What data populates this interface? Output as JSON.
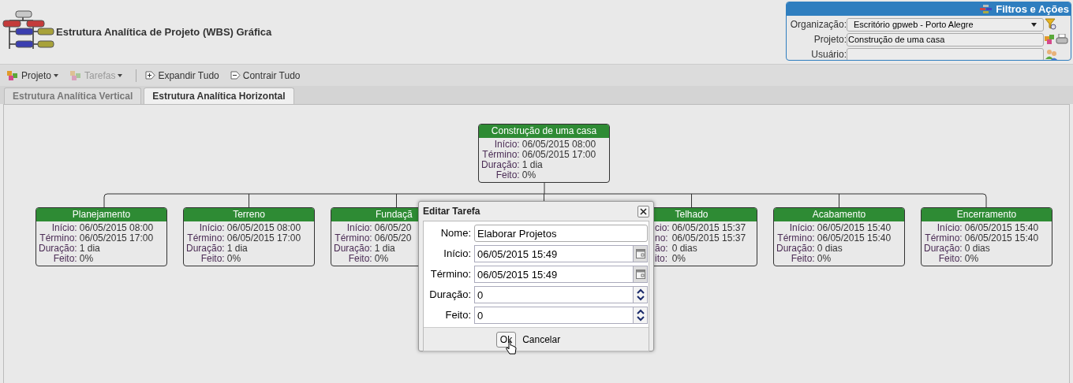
{
  "header": {
    "title": "Estrutura Analítica de Projeto (WBS) Gráfica"
  },
  "filters": {
    "title": "Filtros e Ações",
    "organization": {
      "label": "Organização:",
      "value": "Escritório gpweb - Porto Alegre"
    },
    "project": {
      "label": "Projeto:",
      "value": "Construção de uma casa"
    },
    "user": {
      "label": "Usuário:"
    }
  },
  "toolbar": [
    {
      "label": "Projeto",
      "kind": "menu",
      "disabled": false
    },
    {
      "label": "Tarefas",
      "kind": "menu",
      "disabled": true
    },
    {
      "label": "Expandir Tudo",
      "kind": "expand",
      "disabled": false
    },
    {
      "label": "Contrair Tudo",
      "kind": "collapse",
      "disabled": false
    }
  ],
  "tabs": [
    {
      "label": "Estrutura Analítica Vertical",
      "selected": false
    },
    {
      "label": "Estrutura Analítica Horizontal",
      "selected": true
    }
  ],
  "root": {
    "title": "Construção de uma casa",
    "rows": [
      {
        "label": "Início:",
        "value": "06/05/2015 08:00"
      },
      {
        "label": "Término:",
        "value": "06/05/2015 17:00"
      },
      {
        "label": "Duração:",
        "value": "1 dia"
      },
      {
        "label": "Feito:",
        "value": "0%"
      }
    ]
  },
  "nodes": [
    {
      "kind": "full",
      "title": "Planejamento",
      "rows": [
        {
          "label": "Início:",
          "value": "06/05/2015 08:00"
        },
        {
          "label": "Término:",
          "value": "06/05/2015 17:00"
        },
        {
          "label": "Duração:",
          "value": "1 dia"
        },
        {
          "label": "Feito:",
          "value": "0%"
        }
      ]
    },
    {
      "kind": "full",
      "title": "Terreno",
      "rows": [
        {
          "label": "Início:",
          "value": "06/05/2015 08:00"
        },
        {
          "label": "Término:",
          "value": "06/05/2015 17:00"
        },
        {
          "label": "Duração:",
          "value": "1 dia"
        },
        {
          "label": "Feito:",
          "value": "0%"
        }
      ]
    },
    {
      "kind": "cut_right",
      "title": "Fundaçã",
      "rows": [
        {
          "label": "Início:",
          "value": "06/05/20"
        },
        {
          "label": "Término:",
          "value": "06/05/20"
        },
        {
          "label": "Duração:",
          "value": "1 dia"
        },
        {
          "label": "Feito:",
          "value": "0%"
        }
      ]
    },
    {
      "kind": "hidden"
    },
    {
      "kind": "cut_left",
      "title": "Telhado",
      "rows": [
        {
          "label": "cio:",
          "value": "06/05/2015 15:37"
        },
        {
          "label": "no:",
          "value": "06/05/2015 15:37"
        },
        {
          "label": "ão:",
          "value": "0 dias"
        },
        {
          "label": "ito:",
          "value": "0%"
        }
      ]
    },
    {
      "kind": "full",
      "title": "Acabamento",
      "rows": [
        {
          "label": "Início:",
          "value": "06/05/2015 15:40"
        },
        {
          "label": "Término:",
          "value": "06/05/2015 15:40"
        },
        {
          "label": "Duração:",
          "value": "0 dias"
        },
        {
          "label": "Feito:",
          "value": "0%"
        }
      ]
    },
    {
      "kind": "full",
      "title": "Encerramento",
      "rows": [
        {
          "label": "Início:",
          "value": "06/05/2015 15:40"
        },
        {
          "label": "Término:",
          "value": "06/05/2015 15:40"
        },
        {
          "label": "Duração:",
          "value": "0 dias"
        },
        {
          "label": "Feito:",
          "value": "0%"
        }
      ]
    }
  ],
  "dialog": {
    "title": "Editar Tarefa",
    "fields": [
      {
        "kind": "text",
        "label": "Nome:",
        "value": "Elaborar Projetos"
      },
      {
        "kind": "date",
        "label": "Início:",
        "value": "06/05/2015 15:49"
      },
      {
        "kind": "date",
        "label": "Término:",
        "value": "06/05/2015 15:49"
      },
      {
        "kind": "number",
        "label": "Duração:",
        "value": "0"
      },
      {
        "kind": "number",
        "label": "Feito:",
        "value": "0"
      }
    ],
    "ok": "Ok",
    "cancel": "Cancelar"
  }
}
